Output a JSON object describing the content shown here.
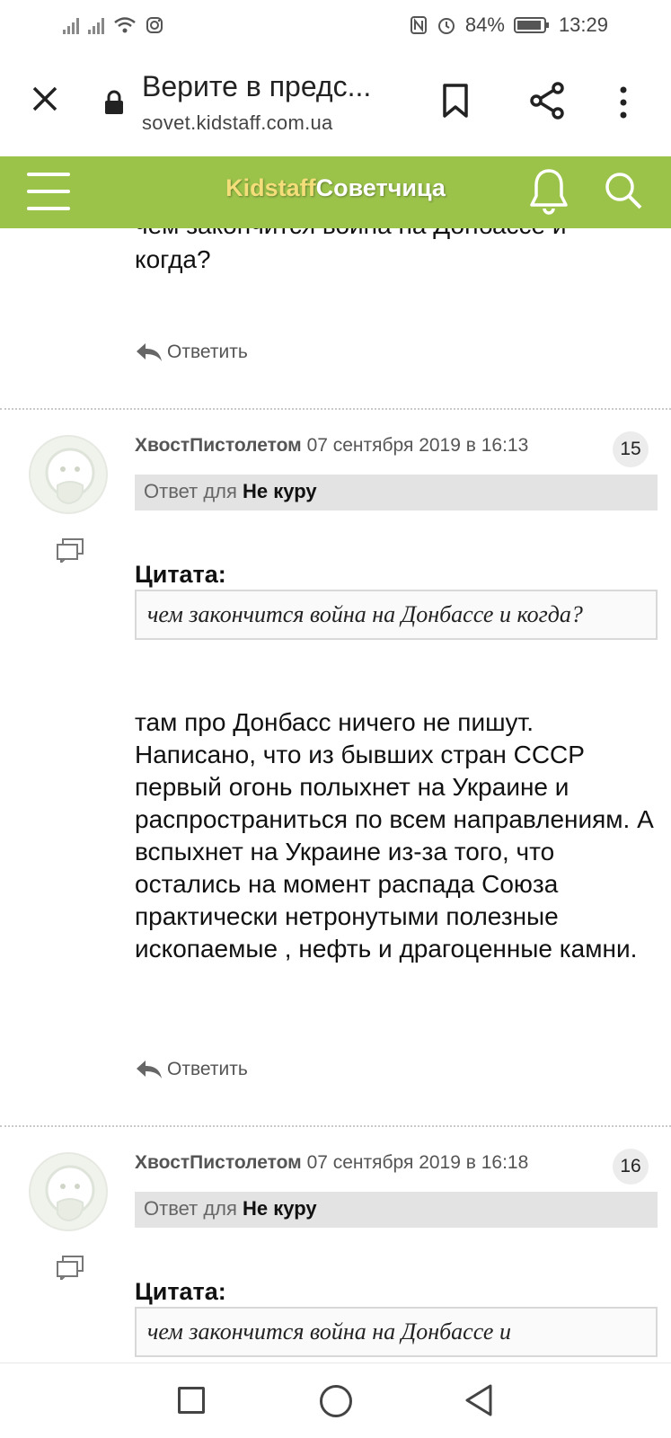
{
  "status": {
    "battery": "84%",
    "time": "13:29"
  },
  "browser": {
    "title": "Верите в предс...",
    "url": "sovet.kidstaff.com.ua"
  },
  "site": {
    "logo_part1": "Kidstaff",
    "logo_part2": "Советчица",
    "accent_color": "#9bc34a"
  },
  "top": {
    "quote_tail": "чем закончится война на Донбассе и когда?",
    "reply_label": "Ответить"
  },
  "posts": [
    {
      "author": "ХвостПистолетом",
      "date": "07 сентября 2019 в 16:13",
      "number": "15",
      "reply_prefix": "Ответ для",
      "reply_to": "Не куру",
      "quote_label": "Цитата:",
      "quote": "чем закончится война на Донбассе и когда?",
      "text": "там про Донбасс ничего не пишут. Написано, что из бывших стран СССР первый огонь полыхнет на Украине и распространиться по всем направлениям. А вспыхнет на Украине из-за того, что остались на момент распада Союза практически нетронутыми полезные ископаемые , нефть и драгоценные камни.",
      "reply_label": "Ответить"
    },
    {
      "author": "ХвостПистолетом",
      "date": "07 сентября 2019 в 16:18",
      "number": "16",
      "reply_prefix": "Ответ для",
      "reply_to": "Не куру",
      "quote_label": "Цитата:",
      "quote": "чем закончится война на Донбассе и"
    }
  ]
}
